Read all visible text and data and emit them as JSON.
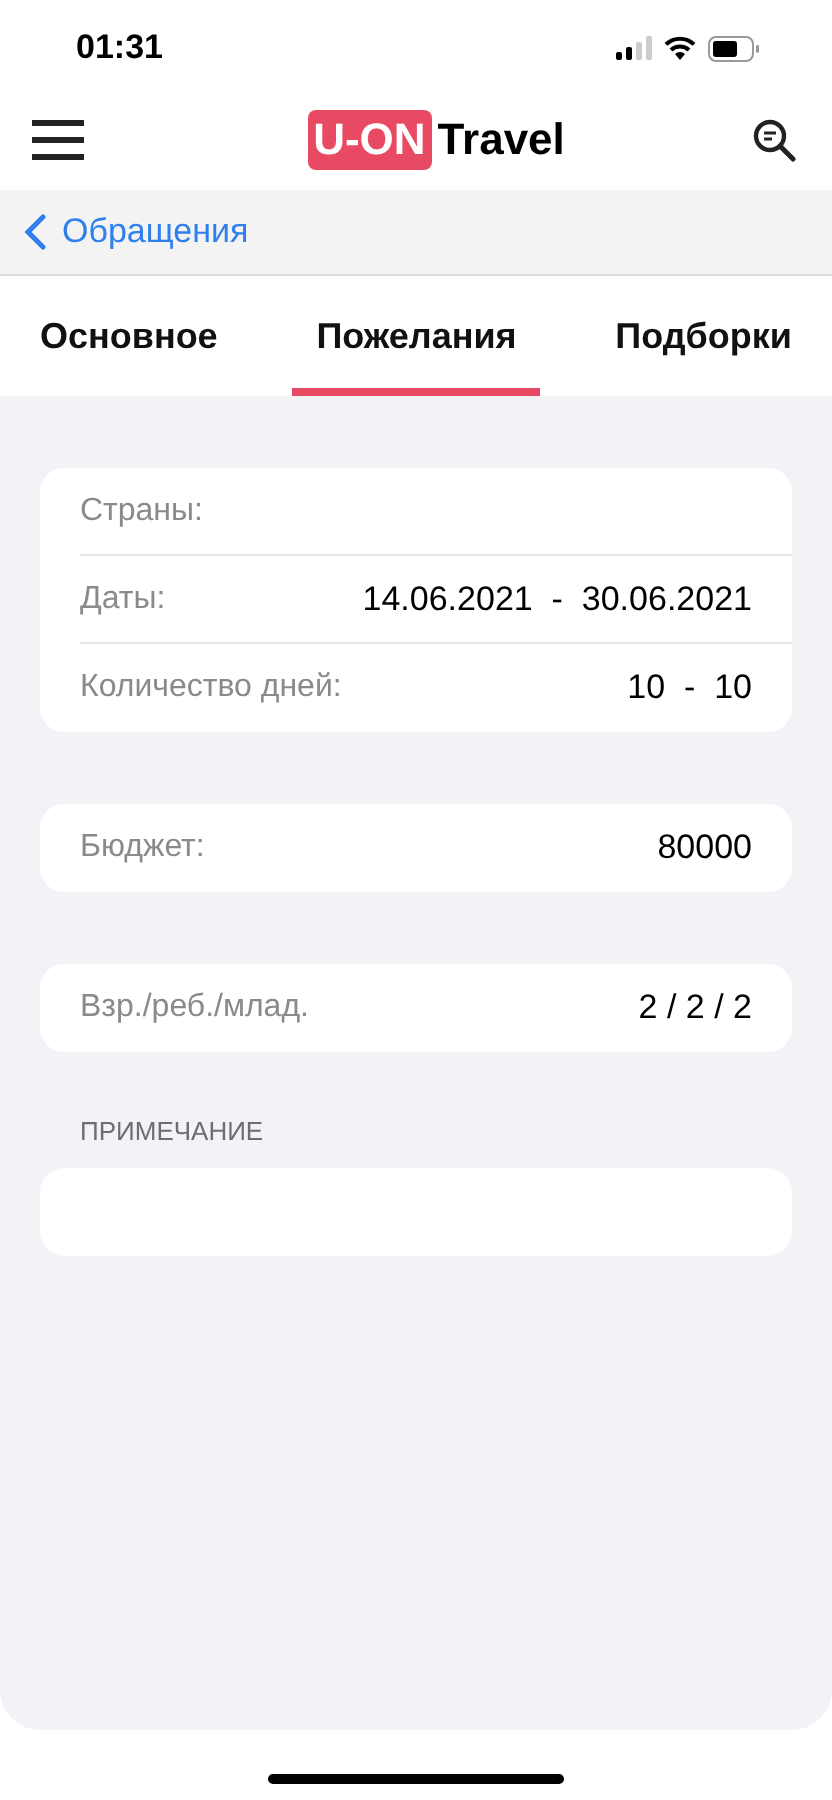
{
  "status_bar": {
    "time": "01:31"
  },
  "header": {
    "logo_badge": "U-ON",
    "logo_text": "Travel"
  },
  "back_link": {
    "label": "Обращения"
  },
  "tabs": [
    {
      "label": "Основное",
      "selected": false
    },
    {
      "label": "Пожелания",
      "selected": true
    },
    {
      "label": "Подборки",
      "selected": false
    }
  ],
  "groups": [
    {
      "rows": [
        {
          "label": "Страны:"
        },
        {
          "label": "Даты:",
          "value": "14.06.2021  -  30.06.2021"
        },
        {
          "label": "Количество дней:",
          "value": "10  -  10"
        }
      ]
    },
    {
      "rows": [
        {
          "label": "Бюджет:",
          "value": "80000"
        }
      ]
    },
    {
      "rows": [
        {
          "label": "Взр./реб./млад.",
          "value": "2 / 2 / 2"
        }
      ]
    }
  ],
  "note": {
    "label": "ПРИМЕЧАНИЕ"
  }
}
